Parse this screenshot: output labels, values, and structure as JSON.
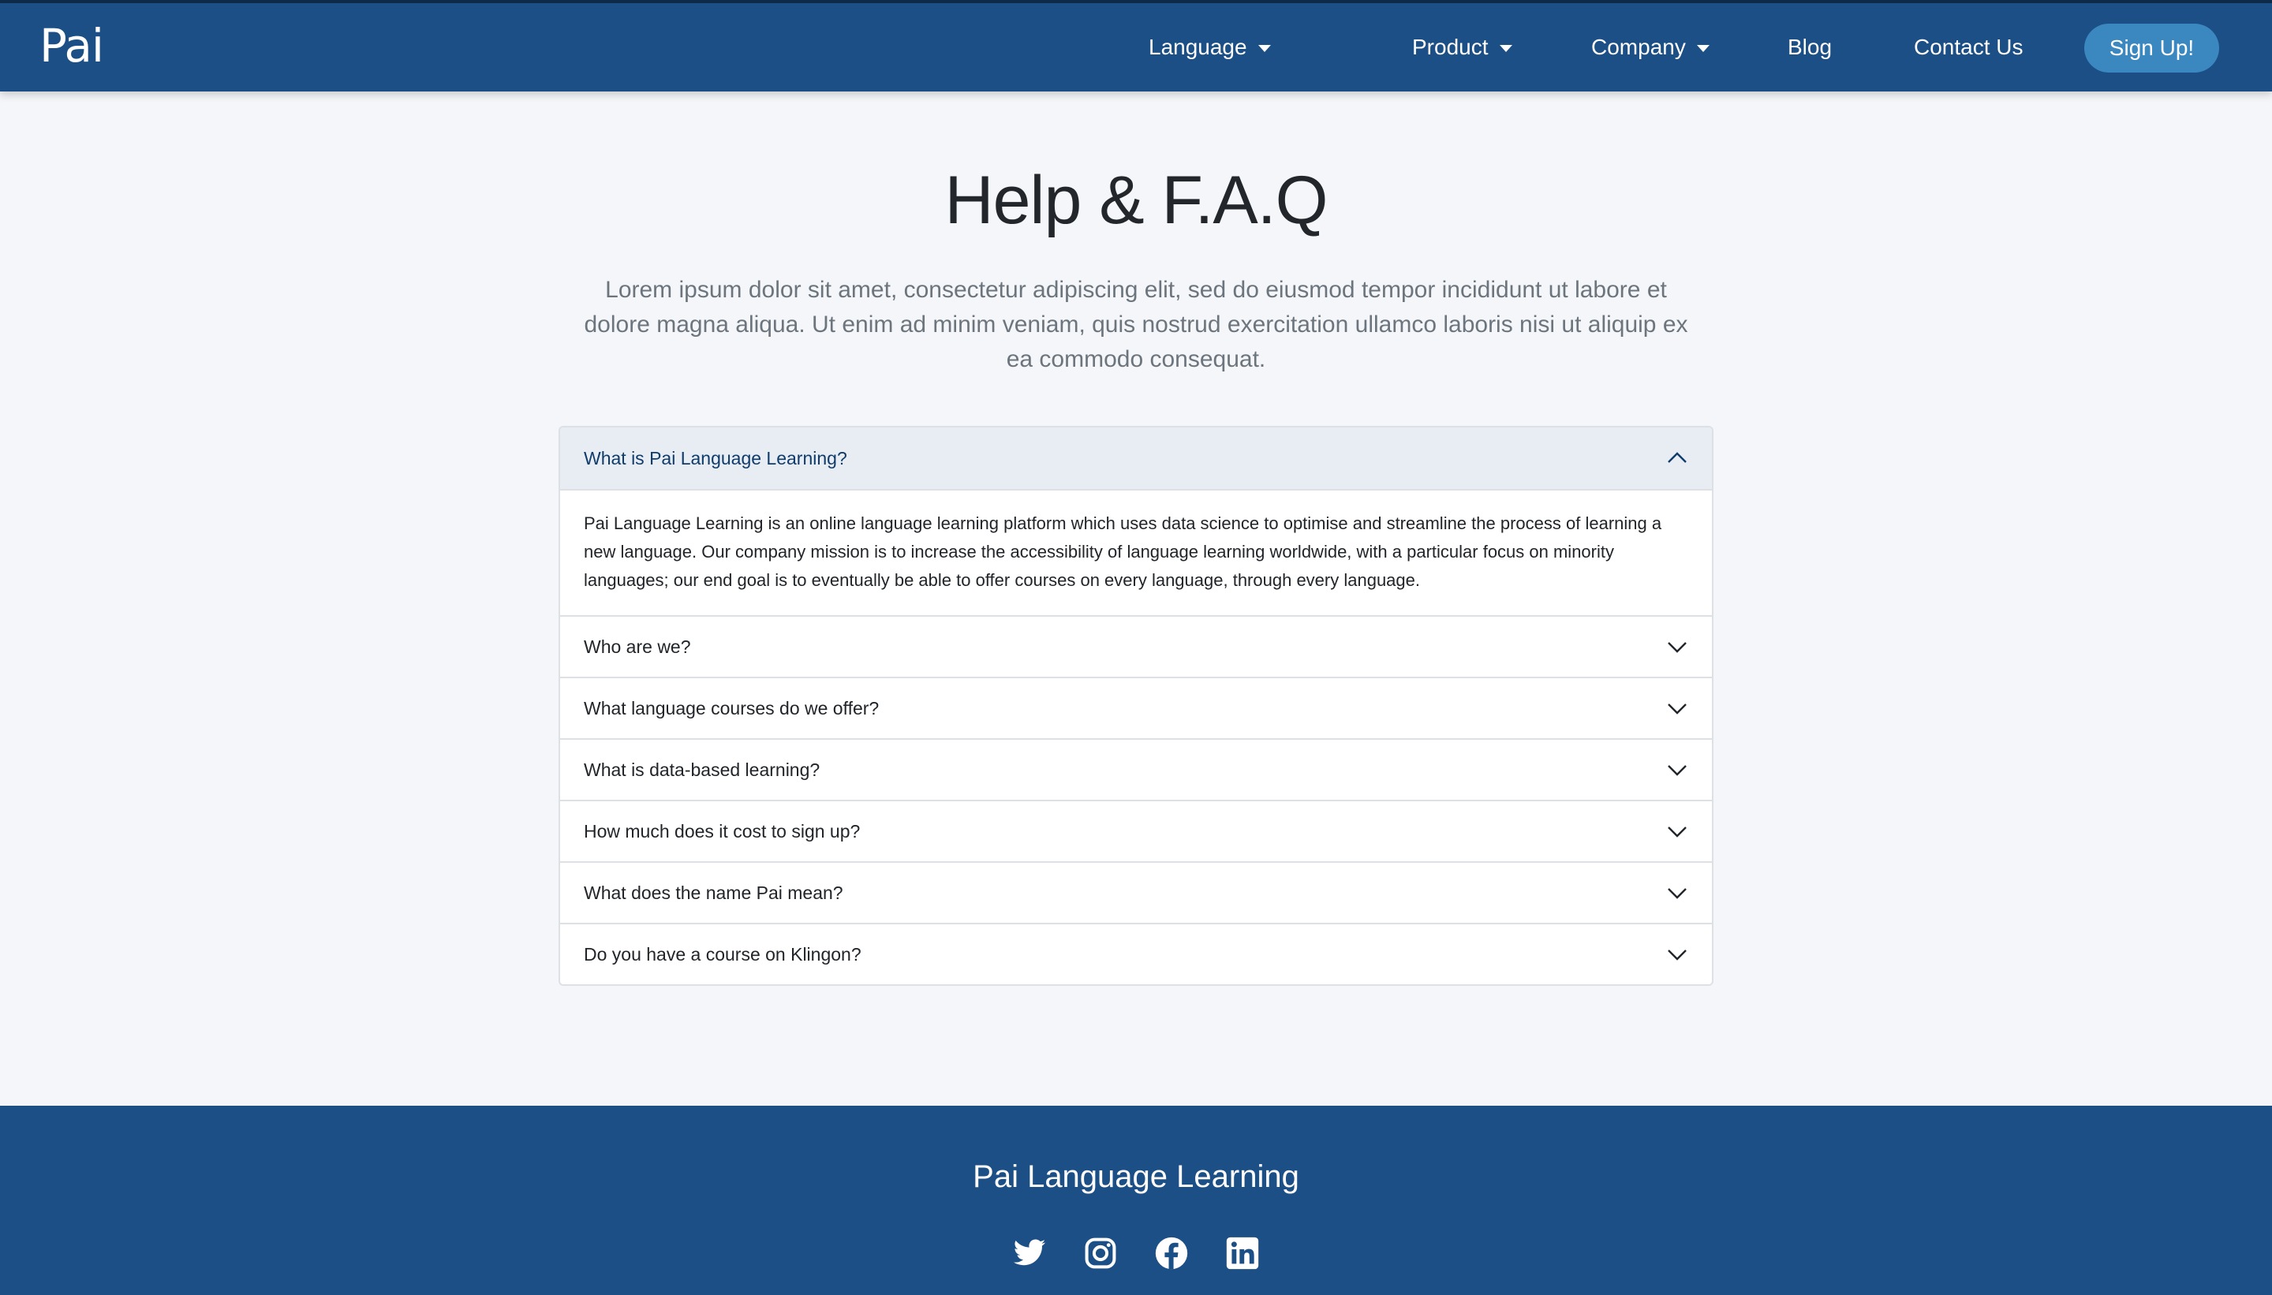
{
  "brand": {
    "name": "Pai"
  },
  "nav": {
    "items": [
      {
        "label": "Language",
        "dropdown": true
      },
      {
        "label": "Product",
        "dropdown": true
      },
      {
        "label": "Company",
        "dropdown": true
      },
      {
        "label": "Blog",
        "dropdown": false
      },
      {
        "label": "Contact Us",
        "dropdown": false
      }
    ],
    "signup_label": "Sign Up!"
  },
  "hero": {
    "title": "Help & F.A.Q",
    "lead": "Lorem ipsum dolor sit amet, consectetur adipiscing elit, sed do eiusmod tempor incididunt ut labore et dolore magna aliqua. Ut enim ad minim veniam, quis nostrud exercitation ullamco laboris nisi ut aliquip ex ea commodo consequat."
  },
  "faq": {
    "items": [
      {
        "question": "What is Pai Language Learning?",
        "expanded": true,
        "answer": "Pai Language Learning is an online language learning platform which uses data science to optimise and streamline the process of learning a new language. Our company mission is to increase the accessibility of language learning worldwide, with a particular focus on minority languages; our end goal is to eventually be able to offer courses on every language, through every language."
      },
      {
        "question": "Who are we?",
        "expanded": false
      },
      {
        "question": "What language courses do we offer?",
        "expanded": false
      },
      {
        "question": "What is data-based learning?",
        "expanded": false
      },
      {
        "question": "How much does it cost to sign up?",
        "expanded": false
      },
      {
        "question": "What does the name Pai mean?",
        "expanded": false
      },
      {
        "question": "Do you have a course on Klingon?",
        "expanded": false
      }
    ]
  },
  "footer": {
    "title": "Pai Language Learning",
    "socials": [
      "twitter-icon",
      "instagram-icon",
      "facebook-icon",
      "linkedin-icon"
    ]
  },
  "colors": {
    "navbar_bg": "#1b4f85",
    "signup_bg": "#3a88bf",
    "page_bg": "#f4f6f9",
    "open_header_bg": "#e8edf4",
    "open_header_text": "#0f3c6b"
  }
}
